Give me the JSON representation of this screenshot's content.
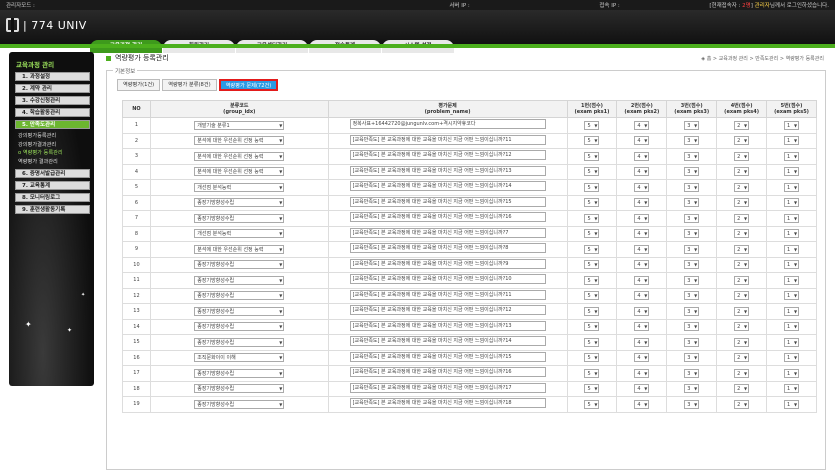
{
  "topbar": {
    "left": "관리자모드 :",
    "server": "서버 IP :",
    "conn": "접속 IP :",
    "right_a": "[현재접속자 : ",
    "count": "2명",
    "right_b": "] ",
    "user": "관리자",
    "right_c": "님께서 로그인하셨습니다."
  },
  "logo": {
    "text": "| 774 UNIV"
  },
  "tabs": [
    "교육과정 관리",
    "회원관리",
    "교육센터관리",
    "접속통계",
    "시스템 설정"
  ],
  "sidebar": {
    "title": "교육과정 관리",
    "menus": [
      {
        "label": "1. 과정설정"
      },
      {
        "label": "2. 계약 관리"
      },
      {
        "label": "3. 수강신청관리"
      },
      {
        "label": "4. 학습활동관리"
      },
      {
        "label": "5. 만족도관리"
      }
    ],
    "subs": [
      "강의평가등록관리",
      "강의평가결과관리",
      "o 역량평가 등록관리",
      "역량평가 결과관리"
    ],
    "menus2": [
      {
        "label": "6. 증명서발급관리"
      },
      {
        "label": "7. 교육통계"
      },
      {
        "label": "8. 모니터링로그"
      },
      {
        "label": "9. 훈련생활동기록"
      }
    ]
  },
  "page": {
    "title": "역량평가 등록관리",
    "breadcrumb": "◈ 홈 > 교육과정 관리 > 만족도관리 > 역량평가 등록관리",
    "fieldset": "기본정보"
  },
  "subtabs": [
    "역량평가(1건)",
    "역량평가 분류(8건)",
    "역량평가 문제(72건)"
  ],
  "headers": {
    "no": "NO",
    "group": "분류코드",
    "group_sub": "(group_idx)",
    "problem": "평가문제",
    "problem_sub": "(problem_name)",
    "p1": "1번(점수)",
    "p2": "2번(점수)",
    "p3": "3번(점수)",
    "p4": "4번(점수)",
    "p5": "5번(점수)",
    "p1s": "(exam pks1)",
    "p2s": "(exam pks2)",
    "p3s": "(exam pks3)",
    "p4s": "(exam pks4)",
    "p5s": "(exam pks5)"
  },
  "rows": [
    {
      "no": "1",
      "group": "개발기술 분류1",
      "problem": "정복사표+16442720@jungunlv.com+격시지약휴코다",
      "s": [
        "5",
        "4",
        "3",
        "2",
        "1"
      ]
    },
    {
      "no": "2",
      "group": "분석에 대한 우선순위 선정 능력",
      "problem": "[교육만족도] 본 교육과정에 대한 교육을 마치신 지금 어떤 느낌이십니까?11",
      "s": [
        "5",
        "4",
        "3",
        "2",
        "1"
      ]
    },
    {
      "no": "3",
      "group": "분석에 대한 우선순위 선정 능력",
      "problem": "[교육만족도] 본 교육과정에 대한 교육을 마치신 지금 어떤 느낌이십니까?12",
      "s": [
        "5",
        "4",
        "3",
        "2",
        "1"
      ]
    },
    {
      "no": "4",
      "group": "분석에 대한 우선순위 선정 능력",
      "problem": "[교육만족도] 본 교육과정에 대한 교육을 마치신 지금 어떤 느낌이십니까?13",
      "s": [
        "5",
        "4",
        "3",
        "2",
        "1"
      ]
    },
    {
      "no": "5",
      "group": "개선점 분석능력",
      "problem": "[교육만족도] 본 교육과정에 대한 교육을 마치신 지금 어떤 느낌이십니까?14",
      "s": [
        "5",
        "4",
        "3",
        "2",
        "1"
      ]
    },
    {
      "no": "6",
      "group": "종장기방향성수립",
      "problem": "[교육만족도] 본 교육과정에 대한 교육을 마치신 지금 어떤 느낌이십니까?15",
      "s": [
        "5",
        "4",
        "3",
        "2",
        "1"
      ]
    },
    {
      "no": "7",
      "group": "종장기방향성수립",
      "problem": "[교육만족도] 본 교육과정에 대한 교육을 마치신 지금 어떤 느낌이십니까?16",
      "s": [
        "5",
        "4",
        "3",
        "2",
        "1"
      ]
    },
    {
      "no": "8",
      "group": "개선점 분석능력",
      "problem": "[교육만족도] 본 교육과정에 대한 교육을 마치신 지금 어떤 느낌이십니까?7",
      "s": [
        "5",
        "4",
        "3",
        "2",
        "1"
      ]
    },
    {
      "no": "9",
      "group": "분석에 대한 우선순위 선정 능력",
      "problem": "[교육만족도] 본 교육과정에 대한 교육을 마치신 지금 어떤 느낌이십니까?8",
      "s": [
        "5",
        "4",
        "3",
        "2",
        "1"
      ]
    },
    {
      "no": "10",
      "group": "종장기방향성수립",
      "problem": "[교육만족도] 본 교육과정에 대한 교육을 마치신 지금 어떤 느낌이십니까?9",
      "s": [
        "5",
        "4",
        "3",
        "2",
        "1"
      ]
    },
    {
      "no": "11",
      "group": "종장기방향성수립",
      "problem": "[교육만족도] 본 교육과정에 대한 교육을 마치신 지금 어떤 느낌이십니까?10",
      "s": [
        "5",
        "4",
        "3",
        "2",
        "1"
      ]
    },
    {
      "no": "12",
      "group": "종장기방향성수립",
      "problem": "[교육만족도] 본 교육과정에 대한 교육을 마치신 지금 어떤 느낌이십니까?11",
      "s": [
        "5",
        "4",
        "3",
        "2",
        "1"
      ]
    },
    {
      "no": "13",
      "group": "종장기방향성수립",
      "problem": "[교육만족도] 본 교육과정에 대한 교육을 마치신 지금 어떤 느낌이십니까?12",
      "s": [
        "5",
        "4",
        "3",
        "2",
        "1"
      ]
    },
    {
      "no": "14",
      "group": "종장기방향성수립",
      "problem": "[교육만족도] 본 교육과정에 대한 교육을 마치신 지금 어떤 느낌이십니까?13",
      "s": [
        "5",
        "4",
        "3",
        "2",
        "1"
      ]
    },
    {
      "no": "15",
      "group": "종장기방향성수립",
      "problem": "[교육만족도] 본 교육과정에 대한 교육을 마치신 지금 어떤 느낌이십니까?14",
      "s": [
        "5",
        "4",
        "3",
        "2",
        "1"
      ]
    },
    {
      "no": "16",
      "group": "조직문화이이 이해",
      "problem": "[교육만족도] 본 교육과정에 대한 교육을 마치신 지금 어떤 느낌이십니까?15",
      "s": [
        "5",
        "4",
        "3",
        "2",
        "1"
      ]
    },
    {
      "no": "17",
      "group": "종장기방향성수립",
      "problem": "[교육만족도] 본 교육과정에 대한 교육을 마치신 지금 어떤 느낌이십니까?16",
      "s": [
        "5",
        "4",
        "3",
        "2",
        "1"
      ]
    },
    {
      "no": "18",
      "group": "종장기방향성수립",
      "problem": "[교육만족도] 본 교육과정에 대한 교육을 마치신 지금 어떤 느낌이십니까?17",
      "s": [
        "5",
        "4",
        "3",
        "2",
        "1"
      ]
    },
    {
      "no": "19",
      "group": "종장기방향성수립",
      "problem": "[교육만족도] 본 교육과정에 대한 교육을 마치신 지금 어떤 느낌이십니까?18",
      "s": [
        "5",
        "4",
        "3",
        "2",
        "1"
      ]
    }
  ]
}
